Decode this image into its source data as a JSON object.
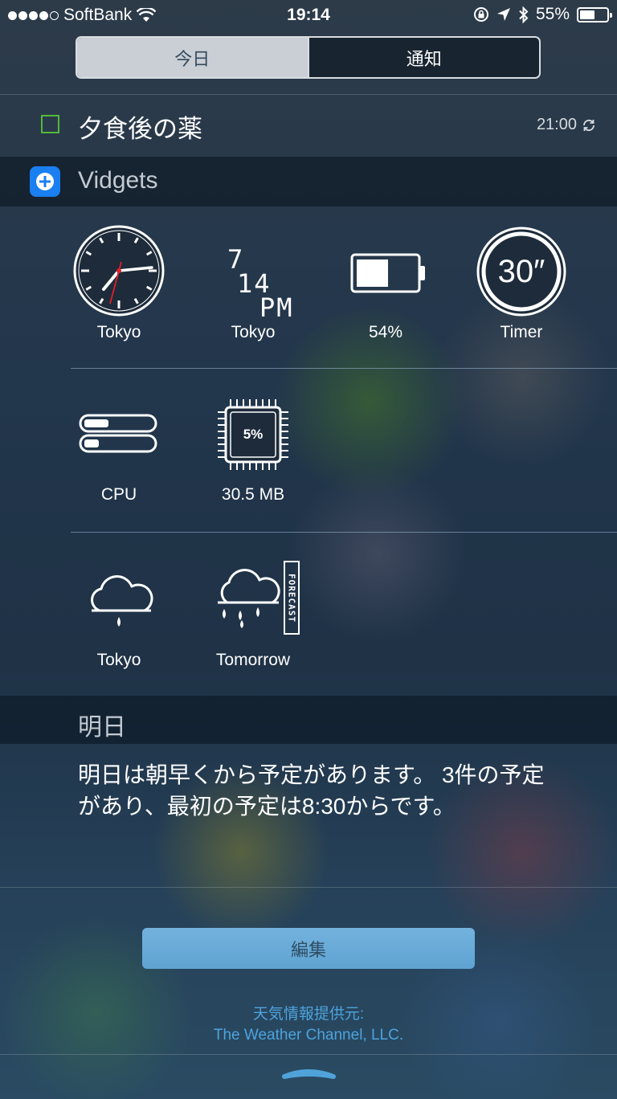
{
  "status_bar": {
    "carrier": "SoftBank",
    "time": "19:14",
    "battery_percent": "55%",
    "battery_level": 0.55,
    "signal_bars_filled": 4,
    "signal_bars_total": 5
  },
  "segment": {
    "tabs": [
      {
        "label": "今日",
        "selected": true
      },
      {
        "label": "通知",
        "selected": false
      }
    ]
  },
  "reminder": {
    "title": "夕食後の薬",
    "time": "21:00",
    "checkbox_color": "#53b83a"
  },
  "vidgets": {
    "app_name": "Vidgets",
    "icon_color": "#1a7ff0",
    "row1": {
      "analog_clock_label": "Tokyo",
      "digital_clock": {
        "hour": "7",
        "minute": "14",
        "ampm": "PM",
        "label": "Tokyo"
      },
      "battery": {
        "label": "54%",
        "level": 0.54
      },
      "timer": {
        "value": "30″",
        "label": "Timer"
      }
    },
    "row2": {
      "cpu_label": "CPU",
      "chip": {
        "value": "5%",
        "label": "30.5 MB"
      }
    },
    "row3": {
      "weather_now_label": "Tokyo",
      "weather_tomorrow_label": "Tomorrow",
      "forecast_text": "FORECAST"
    }
  },
  "tomorrow": {
    "header": "明日",
    "text_line1": "明日は朝早くから予定があります。 3件の予定",
    "text_line2": "があり、最初の予定は8:30からです。"
  },
  "edit_button": "編集",
  "credit": {
    "line1_link": "天気",
    "line1_rest": "情報提供元:",
    "line2": "The Weather Channel, LLC."
  }
}
